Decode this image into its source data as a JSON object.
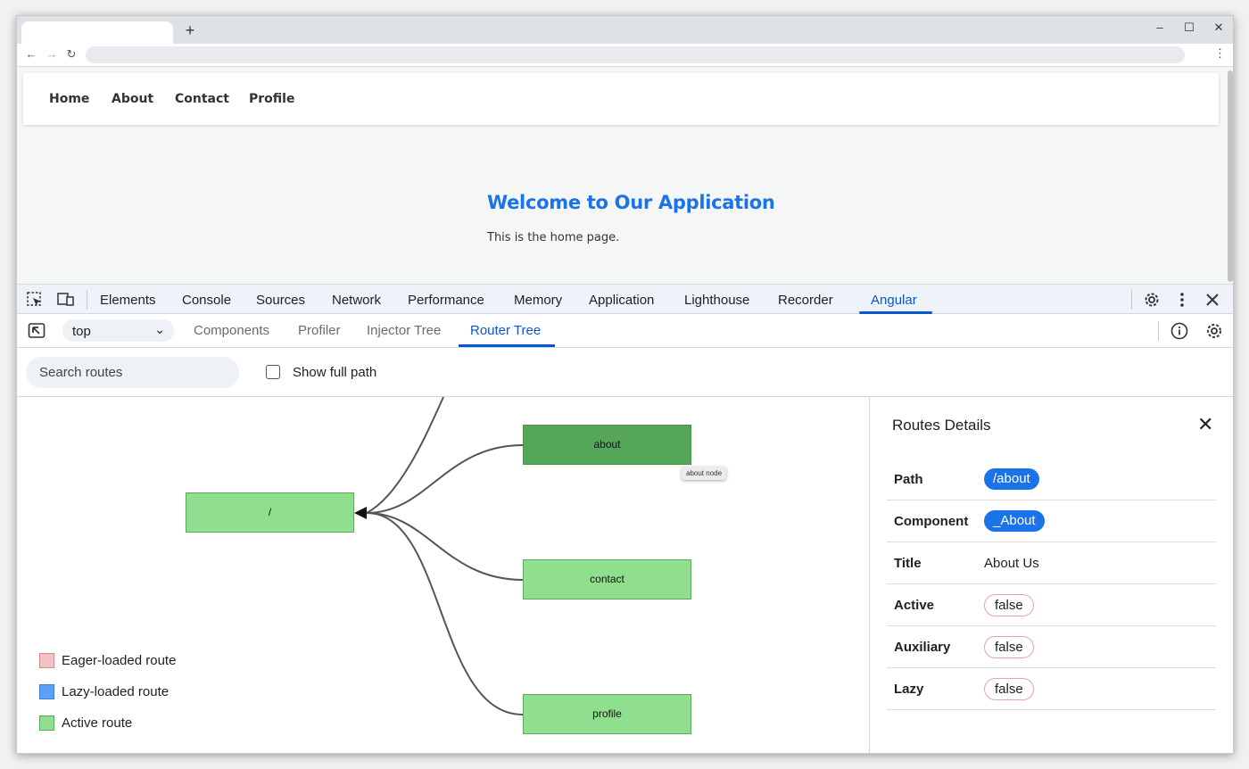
{
  "browser": {
    "new_tab": "+",
    "controls": {
      "minimize": "–",
      "maximize": "☐",
      "close": "✕"
    },
    "nav": {
      "back": "←",
      "forward": "→",
      "reload": "↻"
    },
    "menu": "⋮"
  },
  "page": {
    "nav_links": [
      "Home",
      "About",
      "Contact",
      "Profile"
    ],
    "heading": "Welcome to Our Application",
    "body": "This is the home page."
  },
  "devtools": {
    "tabs": [
      "Elements",
      "Console",
      "Sources",
      "Network",
      "Performance",
      "Memory",
      "Application",
      "Lighthouse",
      "Recorder",
      "Angular"
    ],
    "active_tab": "Angular",
    "icons": [
      "inspect-element-icon",
      "device-toolbar-icon",
      "settings-gear-icon",
      "more-options-icon",
      "close-devtools-icon"
    ]
  },
  "angular": {
    "frame_select": "top",
    "tabs": [
      "Components",
      "Profiler",
      "Injector Tree",
      "Router Tree"
    ],
    "active_tab": "Router Tree",
    "search_placeholder": "Search routes",
    "show_full_path_label": "Show full path",
    "show_full_path_checked": false
  },
  "router_tree": {
    "nodes": {
      "root": "/",
      "about": "about",
      "contact": "contact",
      "profile": "profile"
    },
    "selected": "about",
    "tooltip": "about node",
    "legend": [
      {
        "label": "Eager-loaded route",
        "color": "#f4c2c4",
        "border": "#d98a8e"
      },
      {
        "label": "Lazy-loaded route",
        "color": "#5da0f5",
        "border": "#3b7fd6"
      },
      {
        "label": "Active route",
        "color": "#8fdf8e",
        "border": "#5fa85e"
      }
    ]
  },
  "route_details": {
    "title": "Routes Details",
    "rows": [
      {
        "label": "Path",
        "value": "/about"
      },
      {
        "label": "Component",
        "value": "_About"
      },
      {
        "label": "Title",
        "value": "About Us"
      },
      {
        "label": "Active",
        "value": "false"
      },
      {
        "label": "Auxiliary",
        "value": "false"
      },
      {
        "label": "Lazy",
        "value": "false"
      }
    ]
  },
  "colors": {
    "accent": "#0b57d0",
    "heading_blue": "#1a73e8",
    "active_node": "#56a65a",
    "node": "#8fdf8e"
  }
}
